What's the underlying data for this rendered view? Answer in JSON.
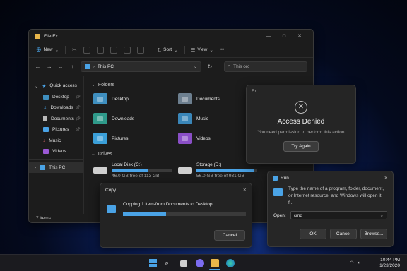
{
  "explorer": {
    "title": "File Ex",
    "window_controls": [
      "—",
      "□",
      "✕"
    ],
    "toolbar": {
      "new_label": "New",
      "sort_label": "Sort",
      "view_label": "View",
      "more_label": "•••"
    },
    "address": {
      "path": "This PC",
      "search_placeholder": "This orc"
    },
    "sidebar": [
      {
        "label": "Quick access",
        "icon": "star-icon"
      },
      {
        "label": "Desktop",
        "icon": "desktop-icon",
        "pinned": true
      },
      {
        "label": "Downloads",
        "icon": "download-icon",
        "pinned": true
      },
      {
        "label": "Documents",
        "icon": "documents-icon",
        "pinned": true
      },
      {
        "label": "Pictures",
        "icon": "pictures-icon",
        "pinned": true
      },
      {
        "label": "Music",
        "icon": "music-icon"
      },
      {
        "label": "Videos",
        "icon": "videos-icon"
      },
      {
        "label": "This PC",
        "icon": "computer-icon"
      }
    ],
    "folders_heading": "Folders",
    "folders": [
      {
        "name": "Desktop",
        "icon": "desktop-folder-icon"
      },
      {
        "name": "Documents",
        "icon": "documents-folder-icon"
      },
      {
        "name": "Downloads",
        "icon": "downloads-folder-icon"
      },
      {
        "name": "Music",
        "icon": "music-folder-icon"
      },
      {
        "name": "Pictures",
        "icon": "pictures-folder-icon"
      },
      {
        "name": "Videos",
        "icon": "videos-folder-icon"
      }
    ],
    "drives_heading": "Drives",
    "drives": [
      {
        "name": "Local Disk (C:)",
        "free": "46.0 GB free of 113 GB",
        "used_fraction": 0.59
      },
      {
        "name": "Storage (D:)",
        "free": "56.0 GB free of 931 GB",
        "used_fraction": 0.94
      }
    ],
    "status": "7 items"
  },
  "access_denied": {
    "title": "Ex",
    "heading": "Access Denied",
    "message": "You need permission to perform this action",
    "button": "Try Again"
  },
  "run": {
    "title": "Run",
    "description": "Type the name of a program, folder, document, or Internet resource, and Windows will open it f...",
    "open_label": "Open:",
    "value": "cmd",
    "ok": "OK",
    "cancel": "Cancel",
    "browse": "Browse..."
  },
  "copy": {
    "title": "Copy",
    "message": "Copping 1 item-from Documents to Desktop",
    "progress": 0.35,
    "cancel": "Cancel"
  },
  "taskbar": {
    "time": "10:44 PM",
    "date": "1/23/2020"
  },
  "colors": {
    "accent": "#4aa3e6",
    "folder": "#e8b64a"
  }
}
